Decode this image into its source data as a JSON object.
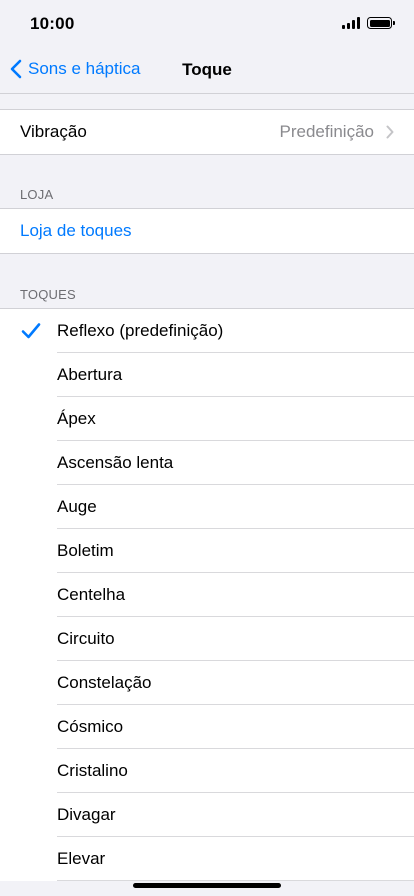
{
  "status_bar": {
    "time": "10:00"
  },
  "nav": {
    "back_label": "Sons e háptica",
    "title": "Toque"
  },
  "vibration": {
    "label": "Vibração",
    "value": "Predefinição"
  },
  "store_section": {
    "header": "LOJA",
    "link_label": "Loja de toques"
  },
  "tones_section": {
    "header": "TOQUES",
    "items": [
      {
        "label": "Reflexo (predefinição)",
        "selected": true
      },
      {
        "label": "Abertura"
      },
      {
        "label": "Ápex"
      },
      {
        "label": "Ascensão lenta"
      },
      {
        "label": "Auge"
      },
      {
        "label": "Boletim"
      },
      {
        "label": "Centelha"
      },
      {
        "label": "Circuito"
      },
      {
        "label": "Constelação"
      },
      {
        "label": "Cósmico"
      },
      {
        "label": "Cristalino"
      },
      {
        "label": "Divagar"
      },
      {
        "label": "Elevar"
      }
    ]
  },
  "colors": {
    "accent": "#007aff",
    "background": "#f2f2f7",
    "secondary_text": "#8a8a8e"
  }
}
